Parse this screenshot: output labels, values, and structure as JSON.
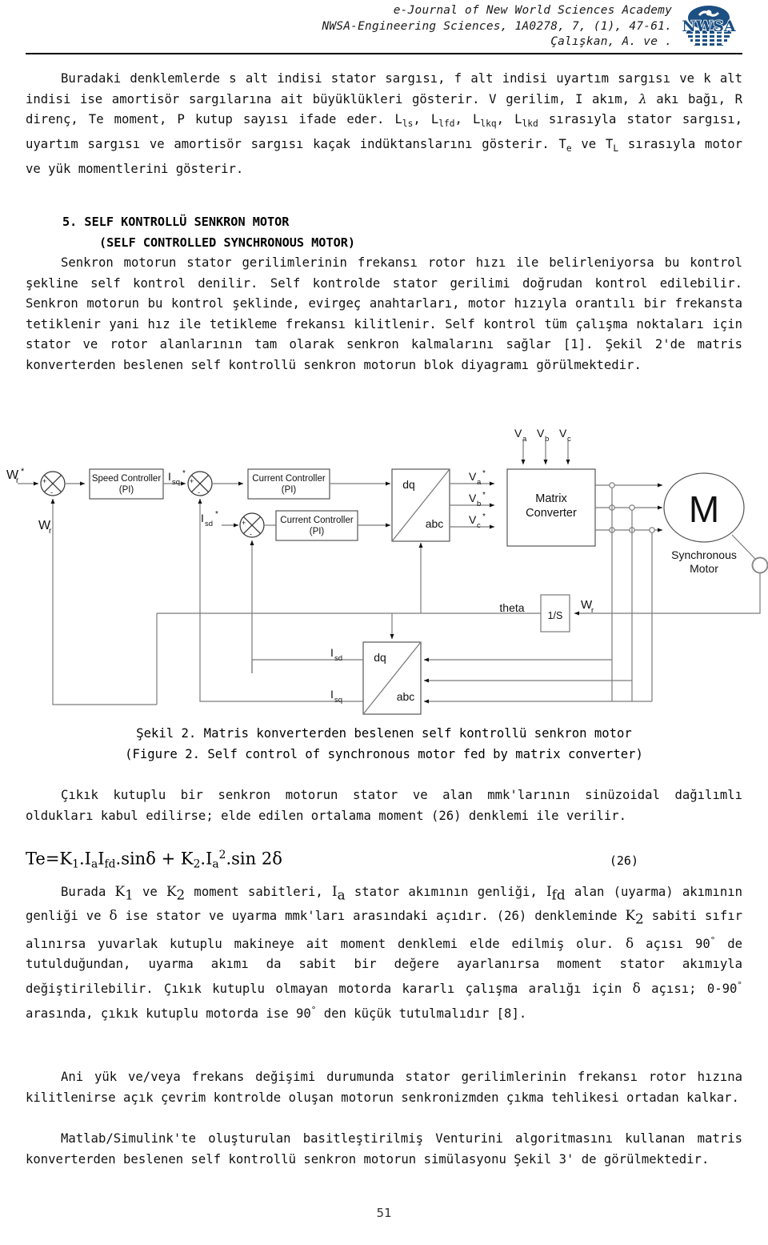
{
  "header": {
    "line1": "e-Journal of New World Sciences Academy",
    "line2": "NWSA-Engineering Sciences, 1A0278, 7, (1), 47-61.",
    "line3": "Çalışkan, A. ve .",
    "logo_text": "NWSA",
    "logo_name": "nwsa-globe-logo"
  },
  "paragraphs": {
    "p1_a": "Buradaki denklemlerde s alt indisi stator sargısı, f alt indisi uyartım sargısı ve k alt indisi ise amortisör sargılarına ait büyüklükleri gösterir.  V gerilim, I akım, ",
    "p1_lambda": "λ",
    "p1_b": " akı bağı, R direnç, Te moment, P kutup sayısı ifade eder. L",
    "p1_ls": "ls",
    "p1_c": ", L",
    "p1_lfd": "lfd",
    "p1_d": ", L",
    "p1_lkq": "lkq",
    "p1_e": ", L",
    "p1_lkd": "lkd",
    "p1_f": " sırasıyla stator sargısı, uyartım sargısı ve amortisör sargısı kaçak indüktanslarını gösterir. T",
    "p1_te": "e",
    "p1_g": " ve T",
    "p1_tl": "L",
    "p1_h": " sırasıyla motor ve yük momentlerini gösterir."
  },
  "heading": {
    "line1": "5. SELF KONTROLLÜ SENKRON MOTOR",
    "line2": "(SELF CONTROLLED SYNCHRONOUS MOTOR)"
  },
  "section_body": "Senkron motorun stator gerilimlerinin frekansı rotor hızı ile belirleniyorsa bu kontrol şekline self kontrol denilir. Self kontrolde stator gerilimi doğrudan kontrol edilebilir. Senkron motorun bu kontrol şeklinde, evirgeç anahtarları, motor hızıyla orantılı bir frekansta tetiklenir yani hız ile tetikleme frekansı kilitlenir. Self kontrol tüm çalışma noktaları için stator ve rotor alanlarının tam olarak senkron kalmalarını sağlar [1].  Şekil 2'de matris konverterden beslenen self kontrollü senkron motorun blok diyagramı görülmektedir.",
  "figure": {
    "name": "block-diagram-self-controlled-synchronous-motor",
    "labels": {
      "wr_ref": "W",
      "wr_ref_sub": "r",
      "wr_ref_star": "*",
      "wr_fb": "W",
      "wr_fb_sub": "r",
      "speed_controller_l1": "Speed Controller",
      "speed_controller_l2": "(PI)",
      "isq_ref": "I",
      "isq_ref_sub": "sq",
      "isq_ref_star": "*",
      "isd_ref": "I",
      "isd_ref_sub": "sd",
      "isd_ref_star": "*",
      "current_controller1_l1": "Current Controller",
      "current_controller1_l2": "(PI)",
      "current_controller2_l1": "Current Controller",
      "current_controller2_l2": "(PI)",
      "dq_top": "dq",
      "abc_top": "abc",
      "dq_bottom": "dq",
      "abc_bottom": "abc",
      "va_in": "V",
      "va_in_sub": "a",
      "vb_in": "V",
      "vb_in_sub": "b",
      "vc_in": "V",
      "vc_in_sub": "c",
      "va_ref": "V",
      "va_ref_sub": "a",
      "va_ref_star": "*",
      "vb_ref": "V",
      "vb_ref_sub": "b",
      "vb_ref_star": "*",
      "vc_ref": "V",
      "vc_ref_sub": "c",
      "vc_ref_star": "*",
      "matrix_converter_l1": "Matrix",
      "matrix_converter_l2": "Converter",
      "motor_symbol": "M",
      "motor_label_l1": "Synchronous",
      "motor_label_l2": "Motor",
      "theta": "theta",
      "integrator": "1/S",
      "wr_out": "W",
      "wr_out_sub": "r",
      "isd_fb": "I",
      "isd_fb_sub": "sd",
      "isq_fb": "I",
      "isq_fb_sub": "sq",
      "plus": "+",
      "minus": "-"
    }
  },
  "caption": {
    "line1": "Şekil 2. Matris konverterden beslenen self kontrollü senkron motor",
    "line2": "(Figure 2. Self control of synchronous motor fed by matrix converter)"
  },
  "paragraph2": "Çıkık kutuplu bir senkron motorun stator ve alan mmk'larının sinüzoidal dağılımlı oldukları kabul edilirse; elde edilen ortalama moment (26) denklemi ile verilir.",
  "equation": {
    "lhs": "Te",
    "eq": "=",
    "k1": "K",
    "k1_sub": "1",
    "dot1": ".I",
    "ia_sub1": "a",
    "if": "I",
    "ifd_sub": "fd",
    "sin1": ".sin",
    "delta1": "δ",
    "plus": "+",
    "k2": "K",
    "k2_sub": "2",
    "dot2": ".I",
    "ia_sub2": "a",
    "sq": "2",
    "sin2": ".sin 2",
    "delta2": "δ",
    "number": "(26)"
  },
  "paragraph3": {
    "a": "Burada ",
    "k1": "K",
    "k1_sub": "1",
    "b": " ve ",
    "k2": "K",
    "k2_sub": "2",
    "c": " moment sabitleri, ",
    "ia": "I",
    "ia_sub": "a",
    "d": " stator akımının genliği, ",
    "ifd": "I",
    "ifd_sub": "fd",
    "e": " alan (uyarma) akımının genliği ve ",
    "delta": "δ",
    "f": " ise stator ve uyarma mmk'ları arasındaki açıdır. (26) denkleminde ",
    "k2b": "K",
    "k2b_sub": "2",
    "g": " sabiti sıfır alınırsa yuvarlak kutuplu makineye ait moment denklemi elde edilmiş olur. ",
    "delta2": "δ",
    "h": " açısı 90",
    "deg1": "°",
    "i": " de tutulduğundan, uyarma akımı da sabit bir değere ayarlanırsa moment stator akımıyla değiştirilebilir. Çıkık kutuplu olmayan motorda kararlı çalışma aralığı için ",
    "delta3": "δ",
    "j": " açısı; 0-90",
    "deg2": "°",
    "k": " arasında, çıkık kutuplu motorda ise 90",
    "deg3": "°",
    "l": " den küçük tutulmalıdır [8]."
  },
  "paragraph4": "Ani yük ve/veya frekans değişimi durumunda stator gerilimlerinin frekansı rotor hızına kilitlenirse açık çevrim kontrolde oluşan motorun senkronizmden çıkma tehlikesi ortadan kalkar.",
  "paragraph5": "Matlab/Simulink'te oluşturulan basitleştirilmiş Venturini algoritmasını kullanan matris konverterden beslenen self kontrollü senkron motorun simülasyonu Şekil 3' de görülmektedir.",
  "page_number": "51",
  "colors": {
    "logo_blue": "#1c4f82",
    "text": "#111111",
    "line": "#808080",
    "dark_line": "#555555"
  }
}
